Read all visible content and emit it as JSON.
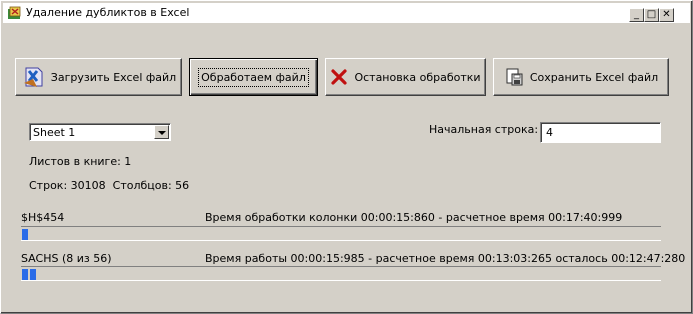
{
  "window": {
    "title": "Удаление дубликтов в Excel",
    "controls": {
      "minimize": "_",
      "maximize": "□",
      "close": "✕"
    }
  },
  "toolbar": {
    "load_label": "Загрузить Excel файл",
    "process_label": "Обработаем файл",
    "stop_label": "Остановка обработки",
    "save_label": "Сохранить Excel файл"
  },
  "sheet_select": {
    "value": "Sheet 1"
  },
  "start_row": {
    "label": "Начальная строка:",
    "value": "4"
  },
  "info": {
    "sheets": "Листов в книге: 1",
    "rows_cols": "Строк: 30108  Столбцов: 56"
  },
  "progress1": {
    "left_label": "$H$454",
    "status": "Время обработки колонки 00:00:15:860 - расчетное время 00:17:40:999",
    "fraction": 0.015
  },
  "progress2": {
    "left_label": "SACHS (8 из 56)",
    "status": "Время работы 00:00:15:985 - расчетное время 00:13:03:265 осталось 00:12:47:280",
    "fraction": 0.03
  },
  "colors": {
    "progress": "#2a6ce8",
    "face": "#d4d0c8"
  }
}
